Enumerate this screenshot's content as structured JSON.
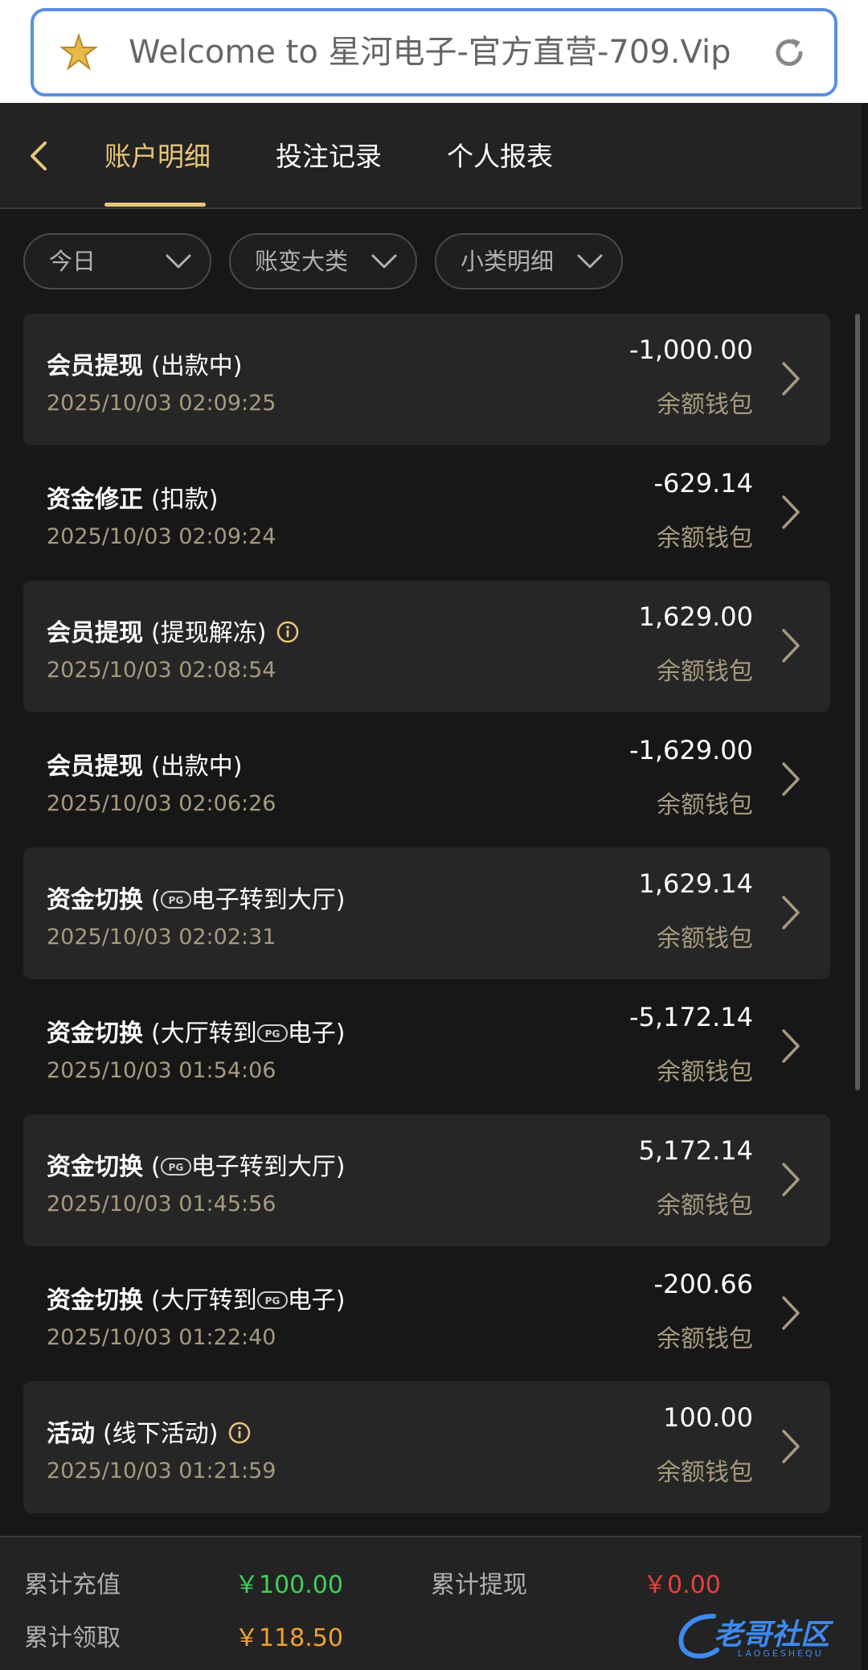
{
  "browser": {
    "url_text": "Welcome to 星河电子-官方直营-709.Vip"
  },
  "header": {
    "tabs": [
      {
        "label": "账户明细",
        "active": true
      },
      {
        "label": "投注记录",
        "active": false
      },
      {
        "label": "个人报表",
        "active": false
      }
    ]
  },
  "filters": [
    {
      "label": "今日"
    },
    {
      "label": "账变大类"
    },
    {
      "label": "小类明细"
    }
  ],
  "records": [
    {
      "title": "会员提现",
      "sub": "(出款中)",
      "info": false,
      "pg": "",
      "time": "2025/10/03 02:09:25",
      "amount": "-1,000.00",
      "wallet": "余额钱包",
      "shaded": true
    },
    {
      "title": "资金修正",
      "sub": "(扣款)",
      "info": false,
      "pg": "",
      "time": "2025/10/03 02:09:24",
      "amount": "-629.14",
      "wallet": "余额钱包",
      "shaded": false
    },
    {
      "title": "会员提现",
      "sub": "(提现解冻)",
      "info": true,
      "pg": "",
      "time": "2025/10/03 02:08:54",
      "amount": "1,629.00",
      "wallet": "余额钱包",
      "shaded": true
    },
    {
      "title": "会员提现",
      "sub": "(出款中)",
      "info": false,
      "pg": "",
      "time": "2025/10/03 02:06:26",
      "amount": "-1,629.00",
      "wallet": "余额钱包",
      "shaded": false
    },
    {
      "title": "资金切换",
      "sub_pre": "(",
      "sub_post": "电子转到大厅)",
      "pg": "pre",
      "info": false,
      "time": "2025/10/03 02:02:31",
      "amount": "1,629.14",
      "wallet": "余额钱包",
      "shaded": true
    },
    {
      "title": "资金切换",
      "sub_pre": "(大厅转到",
      "sub_post": "电子)",
      "pg": "mid",
      "info": false,
      "time": "2025/10/03 01:54:06",
      "amount": "-5,172.14",
      "wallet": "余额钱包",
      "shaded": false
    },
    {
      "title": "资金切换",
      "sub_pre": "(",
      "sub_post": "电子转到大厅)",
      "pg": "pre",
      "info": false,
      "time": "2025/10/03 01:45:56",
      "amount": "5,172.14",
      "wallet": "余额钱包",
      "shaded": true
    },
    {
      "title": "资金切换",
      "sub_pre": "(大厅转到",
      "sub_post": "电子)",
      "pg": "mid",
      "info": false,
      "time": "2025/10/03 01:22:40",
      "amount": "-200.66",
      "wallet": "余额钱包",
      "shaded": false
    },
    {
      "title": "活动",
      "sub": "(线下活动)",
      "info": true,
      "pg": "",
      "time": "2025/10/03 01:21:59",
      "amount": "100.00",
      "wallet": "余额钱包",
      "shaded": true
    }
  ],
  "footer": {
    "total_deposit_label": "累计充值",
    "total_deposit_value": "￥100.00",
    "total_withdraw_label": "累计提现",
    "total_withdraw_value": "￥0.00",
    "total_claim_label": "累计领取",
    "total_claim_value": "￥118.50"
  },
  "watermark": {
    "text": "老哥社区",
    "sub": "LAOGESHEQU"
  },
  "colors": {
    "accent_gold": "#e8c67a",
    "deposit_green": "#3fcf5a",
    "withdraw_red": "#e84040",
    "claim_orange": "#f0a030"
  }
}
